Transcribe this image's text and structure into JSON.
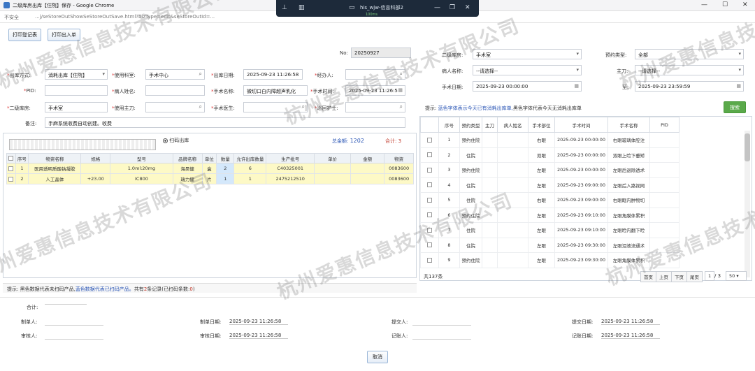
{
  "window": {
    "title": "二级库房出库【住院】保存 - Google Chrome",
    "minimize": "—",
    "maximize": "☐",
    "close": "✕"
  },
  "remote": {
    "title": "his_wjw-信息科部2",
    "icons": [
      "pin-icon",
      "display-icon",
      "network-icon",
      "minimize-icon",
      "restore-icon",
      "close-icon"
    ],
    "signal": "100ms"
  },
  "address": {
    "insecure": "不安全",
    "url": "...j/seStoreOutShowSeStoreOutSave.html?bizType=edit&seStoreOutId=..."
  },
  "toolbar": {
    "print_register": "打印登记表",
    "print_in": "打印出入单"
  },
  "left_form": {
    "no_label": "No:",
    "no_value": "20250927",
    "out_type_label": "出库方式:",
    "out_type_value": "消耗出库【住院】",
    "dept_label": "使用科室:",
    "dept_value": "手术中心",
    "out_date_label": "出库日期:",
    "out_date_value": "2025-09-23 11:26:58",
    "handler_label": "经办人:",
    "handler_value": "",
    "pid_label": "PID:",
    "pid_value": "",
    "patient_label": "病人姓名:",
    "patient_value": "",
    "surgery_label": "手术名称:",
    "surgery_value": "微切口白内障超声乳化",
    "surgery_time_label": "手术时间:",
    "surgery_time_value": "2025-09-23 11:26:5",
    "store_label": "二级库房:",
    "store_value": "手术室",
    "surgeon_label": "使用主刀:",
    "surgeon_value": "",
    "doctor_label": "手术医生:",
    "doctor_value": "",
    "nurse_label": "巡回护士:",
    "nurse_value": "",
    "remark_label": "备注:",
    "remark_value": "手麻系统收费自动创建。收费"
  },
  "scan": {
    "radio_label": "扫码出库",
    "total_amount_label": "总金额:",
    "total_amount": "1202",
    "total_count_label": "合计:",
    "total_count": "3"
  },
  "left_table": {
    "headers": [
      "序号",
      "物资名称",
      "规格",
      "型号",
      "品牌名称",
      "单位",
      "数量",
      "允许出库数量",
      "生产批号",
      "单价",
      "金额",
      "物资"
    ],
    "rows": [
      [
        "1",
        "医用透明质酸钠凝胶",
        "",
        "1.0ml:20mg",
        "海昊健",
        "盒",
        "2",
        "6",
        "C40325001",
        "",
        "",
        "0083600"
      ],
      [
        "2",
        "人工晶体",
        "+23.00",
        "IC800",
        "瑞力健",
        "片",
        "1",
        "1",
        "2475212510",
        "",
        "",
        "0083600"
      ]
    ]
  },
  "hint": {
    "prefix": "提示: 黑色数据代表未扫码产品,",
    "blue_text": "蓝色数据代表已扫码产品。",
    "suffix": "共有",
    "count": "2",
    "suffix2": "条记录(已扫码条数:",
    "scanned": "0",
    "end": ")"
  },
  "right_form": {
    "store_label": "二级库房:",
    "store_value": "手术室",
    "type_label": "预约类型:",
    "type_value": "全部",
    "patient_label": "病人名称:",
    "patient_value": "--请选择--",
    "surgeon_label": "主刀:",
    "surgeon_value": "--请选择--",
    "date_label": "手术日期:",
    "date_from": "2025-09-23 00:00:00",
    "to_label": "至:",
    "date_to": "2025-09-23 23:59:59",
    "hint_prefix": "提示: ",
    "hint_blue": "蓝色字体表示今天已有消耗出库单,",
    "hint_black": "黑色字体代表今天无消耗出库单",
    "search": "搜索"
  },
  "right_table": {
    "headers": [
      "序号",
      "预约类型",
      "主刀",
      "病人姓名",
      "手术部位",
      "手术时间",
      "手术名称",
      "PID"
    ],
    "rows": [
      [
        "1",
        "预约住院",
        "",
        "",
        "右眼",
        "2025-09-23 00:00:00",
        "右眼玻璃体腔注"
      ],
      [
        "2",
        "住院",
        "",
        "",
        "双眼",
        "2025-09-23 00:00:00",
        "双眼上睑下垂矫"
      ],
      [
        "3",
        "预约住院",
        "",
        "",
        "左眼",
        "2025-09-23 00:00:00",
        "左眼后退除透术"
      ],
      [
        "4",
        "住院",
        "",
        "",
        "左眼",
        "2025-09-23 09:00:00",
        "左眼后入路视网"
      ],
      [
        "5",
        "住院",
        "",
        "",
        "右眼",
        "2025-09-23 09:00:00",
        "右眼眶内肿物切"
      ],
      [
        "6",
        "预约住院",
        "",
        "",
        "左眼",
        "2025-09-23 09:10:00",
        "左眼角膜体累积"
      ],
      [
        "7",
        "住院",
        "",
        "",
        "左眼",
        "2025-09-23 09:10:00",
        "左眼睑内翻下睑"
      ],
      [
        "8",
        "住院",
        "",
        "",
        "左眼",
        "2025-09-23 09:30:00",
        "左眼泪液流通术"
      ],
      [
        "9",
        "预约住院",
        "",
        "",
        "左眼",
        "2025-09-23 09:30:00",
        "左眼角膜体累积"
      ]
    ],
    "total": "共137条"
  },
  "pager": {
    "first": "首页",
    "prev": "上页",
    "next": "下页",
    "last": "尾页",
    "page": "1",
    "of": "/ 3",
    "size": "50"
  },
  "footer": {
    "total_label": "合计:",
    "total_value": "",
    "maker_label": "制单人:",
    "maker_value": "",
    "make_date_label": "制单日期:",
    "make_date": "2025-09-23 11:26:58",
    "submitter_label": "提交人:",
    "submitter_value": "",
    "submit_date_label": "提交日期:",
    "submit_date": "2025-09-23 11:26:58",
    "auditor_label": "审核人:",
    "auditor_value": "",
    "audit_date_label": "审核日期:",
    "audit_date": "2025-09-23 11:26:58",
    "booker_label": "记账人:",
    "booker_value": "",
    "book_date_label": "记账日期:",
    "book_date": "2025-09-23 11:26:58",
    "cancel": "取消"
  },
  "watermark": "杭州爱惠信息技术有限公司"
}
